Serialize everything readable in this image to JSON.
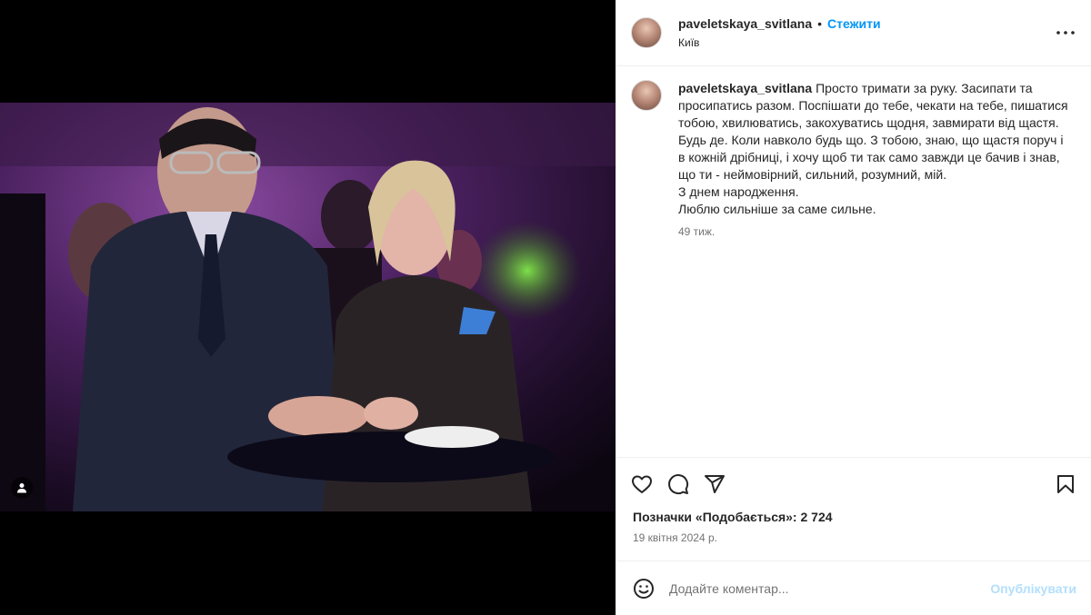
{
  "post": {
    "username": "paveletskaya_svitlana",
    "follow_label": "Стежити",
    "location": "Київ",
    "caption": "Просто тримати за руку. Засипати та просипатись разом. Поспішати до тебе, чекати на тебе, пишатися тобою, хвилюватись, закохуватись щодня, завмирати від щастя. Будь де. Коли навколо будь що. З тобою, знаю, що щастя поруч і в кожній дрібниці, і хочу щоб ти так само завжди це бачив і знав, що ти - неймовірний, сильний, розумний, мій.\nЗ днем народження.\nЛюблю сильніше за саме сильне.",
    "time_ago": "49 тиж.",
    "likes": "Позначки «Подобається»: 2 724",
    "date": "19 квітня 2024 р."
  },
  "comment": {
    "placeholder": "Додайте коментар...",
    "publish_label": "Опублікувати"
  },
  "icons": {
    "more": "more-options-icon",
    "like": "heart-icon",
    "comment": "comment-icon",
    "share": "share-icon",
    "save": "bookmark-icon",
    "emoji": "emoji-icon",
    "tag": "user-tag-icon"
  },
  "colors": {
    "accent": "#0095f6",
    "publish_disabled": "#b2dffc",
    "secondary_text": "#737373"
  }
}
